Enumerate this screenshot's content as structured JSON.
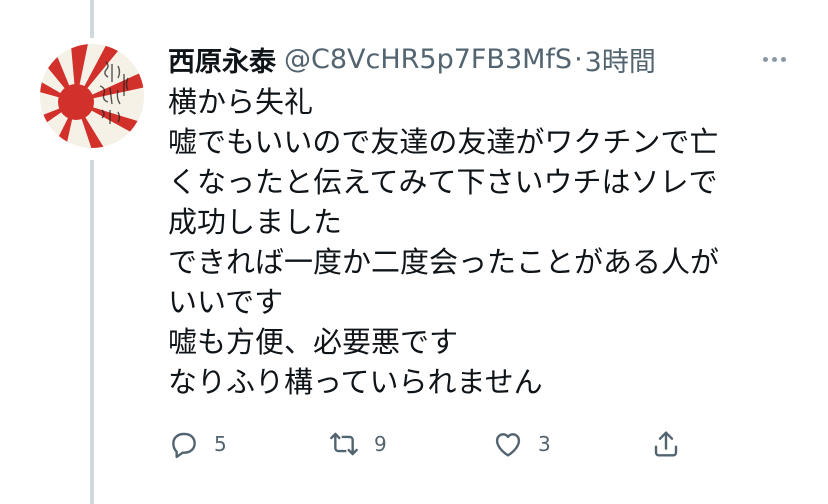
{
  "tweet": {
    "author_name": "西原永泰",
    "handle": "@C8VcHR5p7FB3MfS",
    "separator": "·",
    "time": "3時間",
    "body_lines": [
      "横から失礼",
      "嘘でもいいので友達の友達がワクチンで亡",
      "くなったと伝えてみて下さいウチはソレで",
      "成功しました",
      "できれば一度か二度会ったことがある人が",
      "いいです",
      "嘘も方便、必要悪です",
      "なりふり構っていられません"
    ]
  },
  "actions": {
    "reply_count": "5",
    "retweet_count": "9",
    "like_count": "3"
  },
  "icons": {
    "reply": "reply-icon",
    "retweet": "retweet-icon",
    "like": "heart-icon",
    "share": "share-icon",
    "more": "more-icon"
  },
  "colors": {
    "secondary_text": "#536471",
    "thread_line": "#cfd9de",
    "avatar_rays": "#d1302b"
  }
}
